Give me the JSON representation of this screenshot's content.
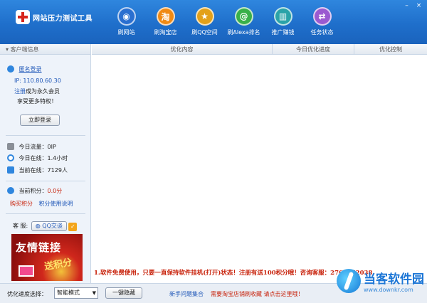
{
  "app": {
    "title": "网站压力测试工具"
  },
  "toolbar": [
    {
      "label": "刷网站",
      "icon": "globe-icon",
      "glyph": "◉",
      "color": "#2a6fd0"
    },
    {
      "label": "刷淘宝店",
      "icon": "taobao-icon",
      "glyph": "淘",
      "color": "#f08a14"
    },
    {
      "label": "刷QQ空间",
      "icon": "star-icon",
      "glyph": "★",
      "color": "#e3a11a"
    },
    {
      "label": "刷Alexa排名",
      "icon": "at-icon",
      "glyph": "@",
      "color": "#39b04a"
    },
    {
      "label": "推广赚钱",
      "icon": "building-icon",
      "glyph": "▥",
      "color": "#2aa3a8"
    },
    {
      "label": "任务状态",
      "icon": "swap-icon",
      "glyph": "⇄",
      "color": "#9a5ad0"
    }
  ],
  "window_controls": {
    "minimize": "–",
    "close": "×"
  },
  "sidebar": {
    "header": "客户端信息",
    "login_link": "匿名登录",
    "ip": "IP: 110.80.60.30",
    "register_link": "注册",
    "register_text": "成为永久会员",
    "privilege": "享受更多特权！",
    "login_button": "立即登录",
    "traffic": "今日流量：0IP",
    "online_today": "今日在线：1.4小时",
    "online_now": "当前在线：7129人",
    "points_label": "当前积分：",
    "points_value": "0.0分",
    "buy_points": "购买积分",
    "points_help": "积分使用说明",
    "service_label": "客 服:",
    "qq_button": "QQ交谈",
    "banner_title": "友情链接",
    "banner_sub": "送积分"
  },
  "table": {
    "columns": [
      "优化内容",
      "今日优化进度",
      "优化控制"
    ]
  },
  "notice": {
    "text": "1.软件免费使用，只要一直保持软件挂机(打开)状态！注册有送100积分哦！咨询客服：",
    "phone": "2767972038"
  },
  "bottom": {
    "speed_label": "优化速度选择：",
    "speed_value": "智能模式",
    "hide_button": "一键隐藏",
    "faq_link": "新手问题集合",
    "promo_link": "需要淘宝店铺刷收藏 请点击这里哦！"
  },
  "watermark": {
    "title": "当客软件园",
    "url": "www.downkr.com"
  }
}
